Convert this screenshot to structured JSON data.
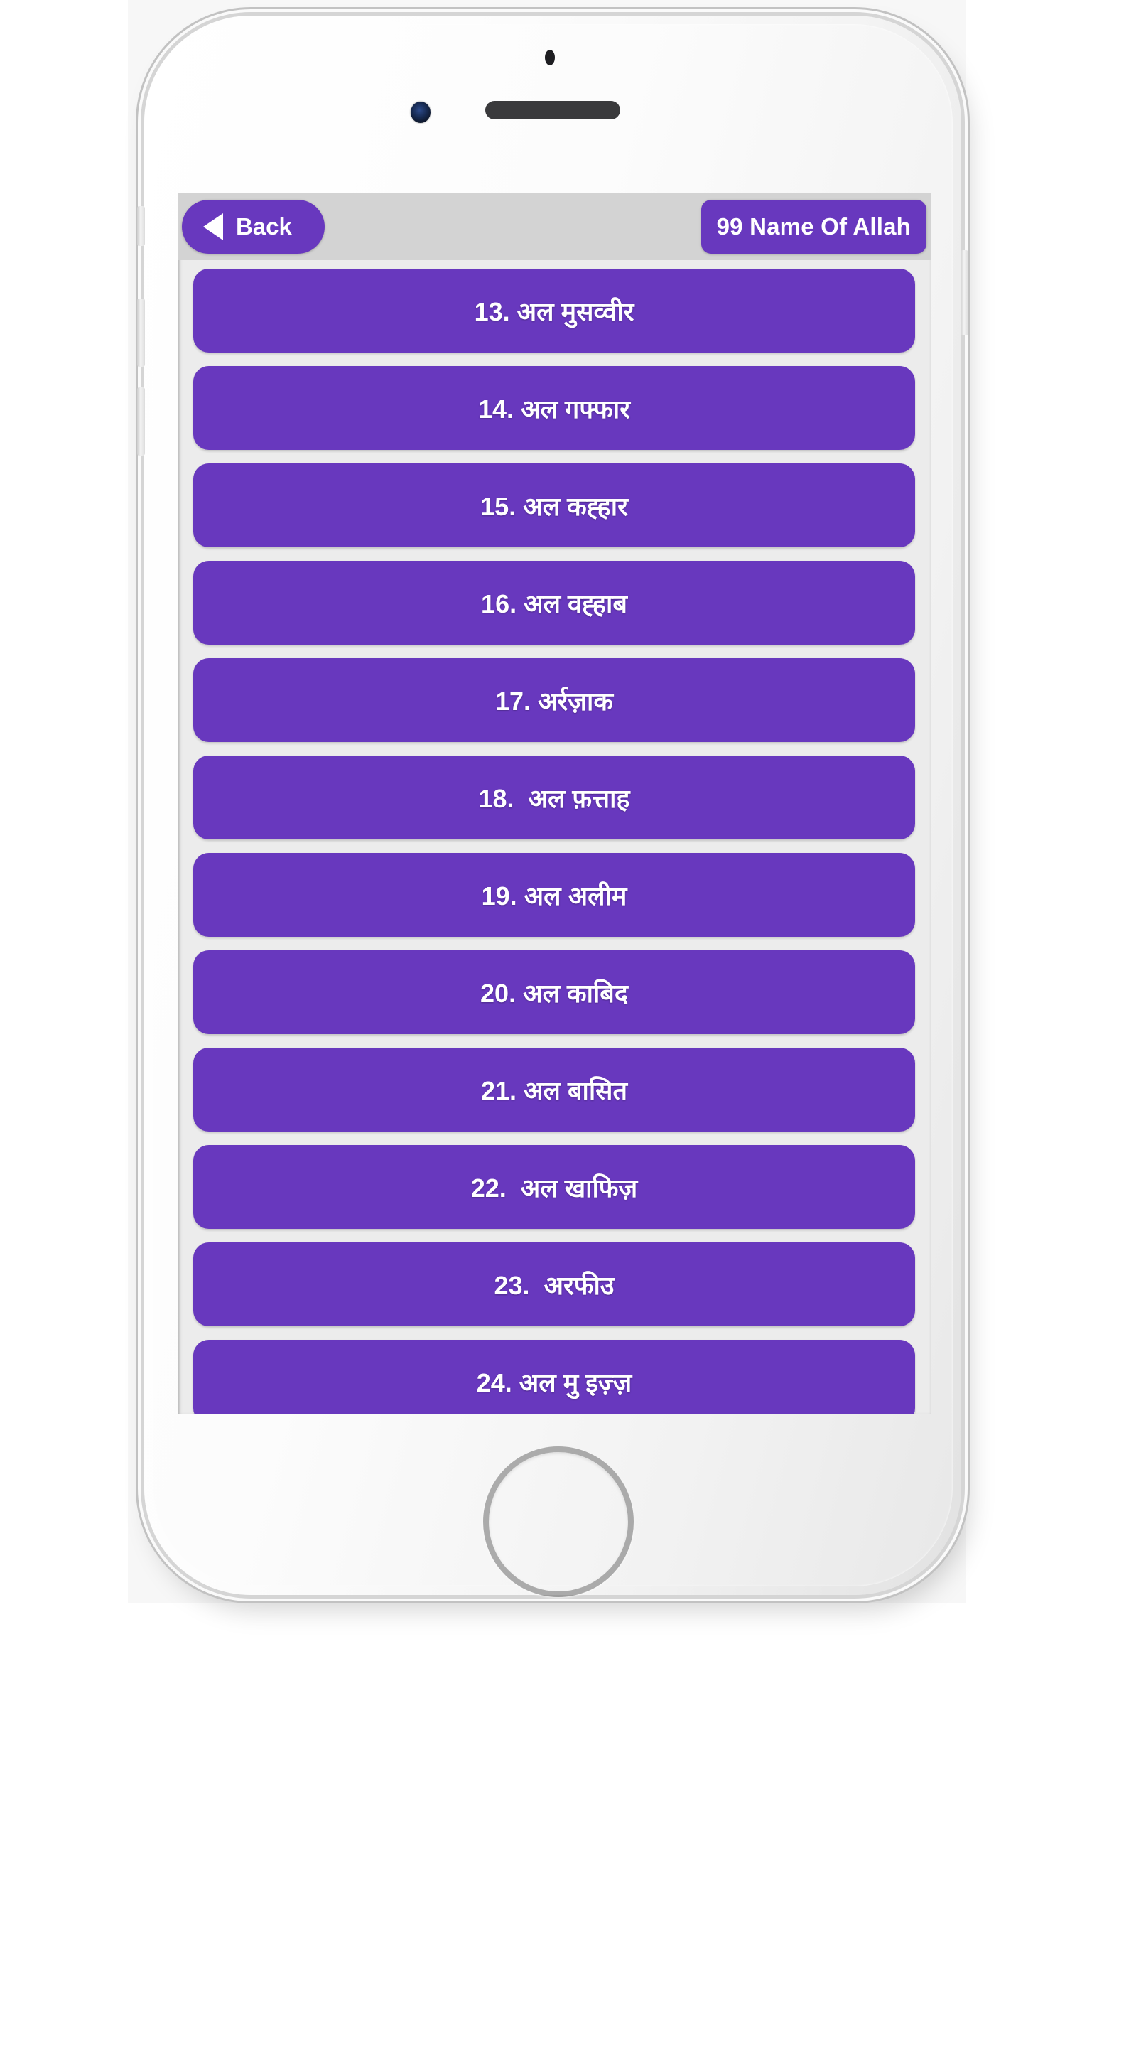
{
  "device": {
    "type": "white-smartphone-mockup",
    "hardware": {
      "proximity_sensor": "proximity-sensor",
      "front_camera": "front-camera",
      "earpiece": "earpiece-speaker",
      "mute_switch": "mute-switch",
      "volume_up": "volume-up",
      "volume_down": "volume-down",
      "power_button": "power-button",
      "home_button": "home-button"
    }
  },
  "colors": {
    "accent_purple": "#6838BE",
    "header_bar": "#d3d3d3",
    "screen_background": "#ececec",
    "text_on_accent": "#ffffff"
  },
  "header": {
    "back_label": "Back",
    "back_icon": "triangle-left-icon",
    "title": "99 Name Of Allah"
  },
  "list": {
    "items": [
      {
        "label": "13. अल मुसव्वीर"
      },
      {
        "label": "14. अल गफ्फार"
      },
      {
        "label": "15. अल कह्हार"
      },
      {
        "label": "16. अल वह्हाब"
      },
      {
        "label": "17. अर्रज़ाक"
      },
      {
        "label": "18.  अल फ़त्ताह"
      },
      {
        "label": "19. अल अलीम"
      },
      {
        "label": "20. अल काबिद"
      },
      {
        "label": "21. अल बासित"
      },
      {
        "label": "22.  अल खाफिज़"
      },
      {
        "label": "23.  अरफीउ"
      },
      {
        "label": "24. अल मु इज़्ज़"
      }
    ]
  }
}
